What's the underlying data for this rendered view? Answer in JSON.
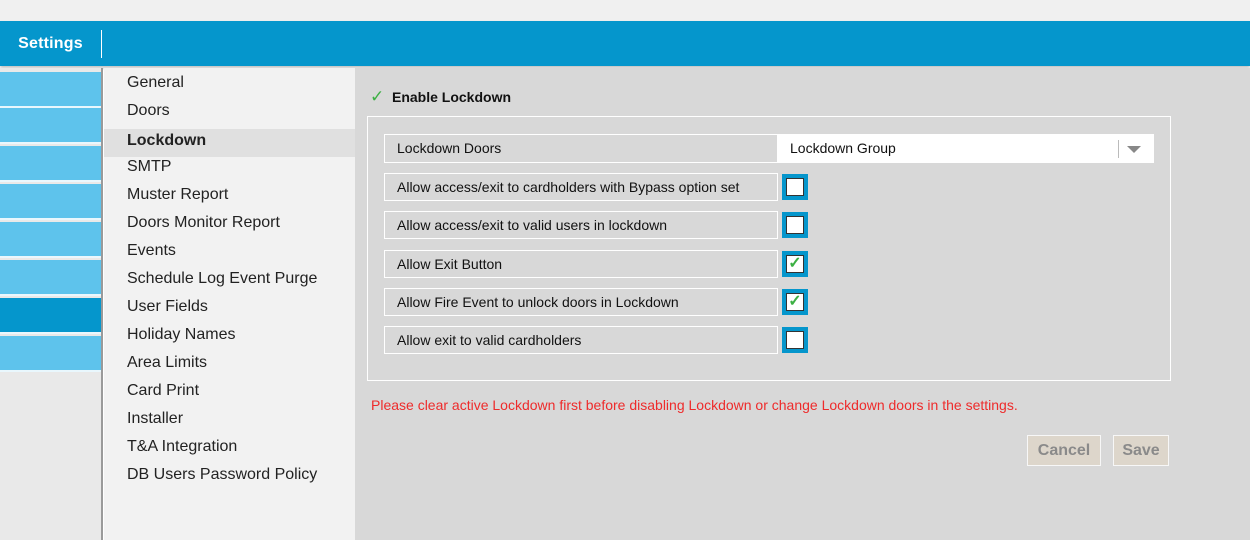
{
  "header": {
    "title": "Settings"
  },
  "rail": {
    "items": 8,
    "active_index": 6
  },
  "menu": {
    "items": [
      {
        "label": "General"
      },
      {
        "label": "Doors"
      },
      {
        "label": "Lockdown",
        "active": true
      },
      {
        "label": "SMTP"
      },
      {
        "label": "Muster Report"
      },
      {
        "label": "Doors Monitor Report"
      },
      {
        "label": "Events"
      },
      {
        "label": "Schedule Log Event Purge"
      },
      {
        "label": "User Fields"
      },
      {
        "label": "Holiday Names"
      },
      {
        "label": "Area Limits"
      },
      {
        "label": "Card Print"
      },
      {
        "label": "Installer"
      },
      {
        "label": "T&A Integration"
      },
      {
        "label": "DB Users Password Policy"
      }
    ]
  },
  "lockdown": {
    "enable_label": "Enable Lockdown",
    "enabled": true,
    "doors_label": "Lockdown Doors",
    "doors_value": "Lockdown Group",
    "options": [
      {
        "label": "Allow access/exit to cardholders with Bypass option set",
        "checked": false
      },
      {
        "label": "Allow access/exit to valid users in lockdown",
        "checked": false
      },
      {
        "label": "Allow Exit Button",
        "checked": true
      },
      {
        "label": "Allow Fire Event to unlock doors in Lockdown",
        "checked": true
      },
      {
        "label": "Allow exit to valid cardholders",
        "checked": false
      }
    ],
    "warning": "Please clear active Lockdown first before disabling Lockdown or change Lockdown doors in the settings."
  },
  "buttons": {
    "cancel": "Cancel",
    "save": "Save"
  },
  "colors": {
    "accent": "#0596cc",
    "rail_light": "#5ec3ec",
    "warning": "#ee2b2b",
    "check": "#3cb043"
  }
}
